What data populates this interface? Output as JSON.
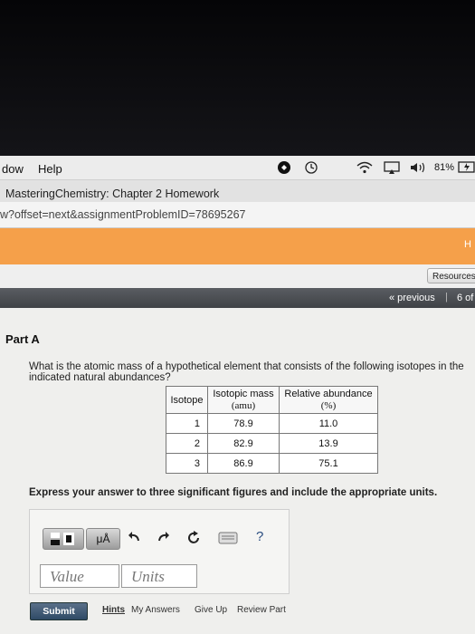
{
  "menubar": {
    "items": [
      "dow",
      "Help"
    ],
    "battery": "81%"
  },
  "window": {
    "title": "MasteringChemistry: Chapter 2 Homework"
  },
  "browser": {
    "url": "w?offset=next&assignmentProblemID=78695267"
  },
  "banner": {
    "right_letter": "H"
  },
  "toolbar": {
    "resources_label": "Resources"
  },
  "nav": {
    "previous_label": "« previous",
    "separator": "|",
    "counter": "6 of"
  },
  "problem": {
    "part_label": "Part A",
    "question_line1": "What is the atomic mass of a hypothetical element that consists of the following isotopes in the",
    "question_line2": "indicated natural abundances?",
    "table": {
      "headers": [
        "Isotope",
        "Isotopic mass",
        "(amu)",
        "Relative abundance",
        "(%)"
      ],
      "rows": [
        {
          "isotope": "1",
          "mass": "78.9",
          "abundance": "11.0"
        },
        {
          "isotope": "2",
          "mass": "82.9",
          "abundance": "13.9"
        },
        {
          "isotope": "3",
          "mass": "86.9",
          "abundance": "75.1"
        }
      ]
    },
    "instructions": "Express your answer to three significant figures and include the appropriate units."
  },
  "answer": {
    "units_tool_label": "μÅ",
    "help_label": "?",
    "value_placeholder": "Value",
    "units_placeholder": "Units"
  },
  "actions": {
    "submit": "Submit",
    "hints": "Hints",
    "my_answers": "My Answers",
    "give_up": "Give Up",
    "review_part": "Review Part"
  }
}
